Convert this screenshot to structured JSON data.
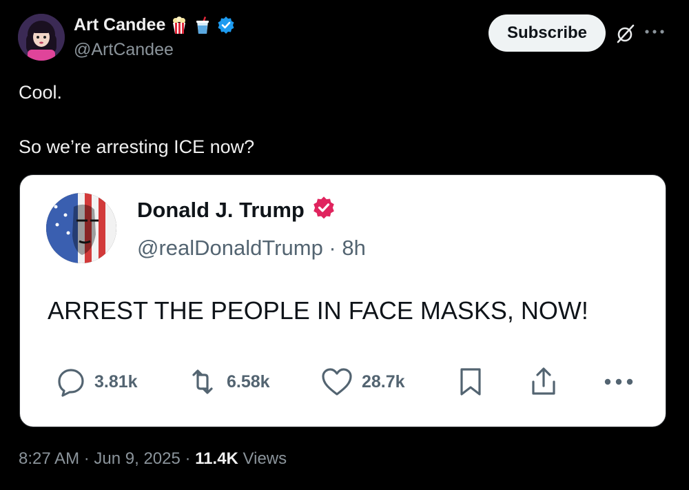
{
  "author": {
    "display_name": "Art Candee",
    "handle": "@ArtCandee",
    "badges": [
      "popcorn-icon",
      "drink-cup-icon",
      "verified-badge-icon"
    ],
    "verified_color": "#1d9bf0"
  },
  "header": {
    "subscribe_label": "Subscribe",
    "grok_icon": "grok-icon",
    "more_icon": "more-horizontal-icon"
  },
  "body": {
    "lines": [
      "Cool.",
      "So we’re arresting ICE now?"
    ]
  },
  "quoted": {
    "display_name": "Donald J. Trump",
    "handle": "@realDonaldTrump",
    "separator": " · ",
    "age": "8h",
    "verified_color": "#e0245e",
    "text": "ARREST THE PEOPLE IN FACE MASKS, NOW!",
    "stats": {
      "replies": "3.81k",
      "reposts": "6.58k",
      "likes": "28.7k"
    }
  },
  "footer": {
    "time": "8:27 AM",
    "sep1": " · ",
    "date": "Jun 9, 2025",
    "sep2": " · ",
    "views_count": "11.4K",
    "views_label": " Views"
  }
}
